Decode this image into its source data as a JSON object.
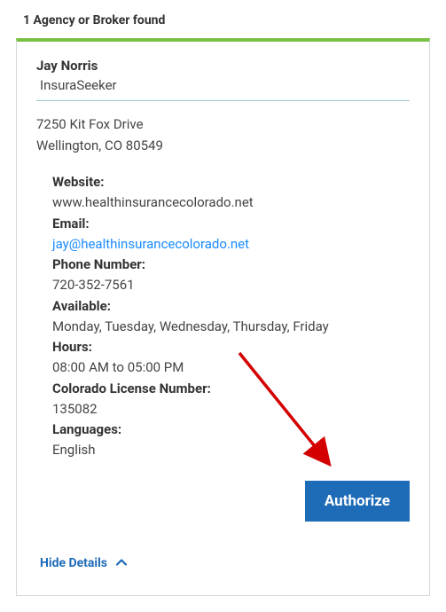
{
  "results": {
    "heading": "1 Agency or Broker found"
  },
  "broker": {
    "name": "Jay Norris",
    "agency": "InsuraSeeker",
    "address_line1": "7250 Kit Fox Drive",
    "address_line2": "Wellington, CO 80549",
    "website_label": "Website:",
    "website": "www.healthinsurancecolorado.net",
    "email_label": "Email:",
    "email": "jay@healthinsurancecolorado.net",
    "phone_label": "Phone Number:",
    "phone": "720-352-7561",
    "available_label": "Available:",
    "available": "Monday, Tuesday, Wednesday, Thursday, Friday",
    "hours_label": "Hours:",
    "hours": "08:00 AM to 05:00 PM",
    "license_label": "Colorado License Number:",
    "license": "135082",
    "languages_label": "Languages:",
    "languages": "English"
  },
  "actions": {
    "authorize_label": "Authorize",
    "toggle_label": "Hide Details"
  }
}
